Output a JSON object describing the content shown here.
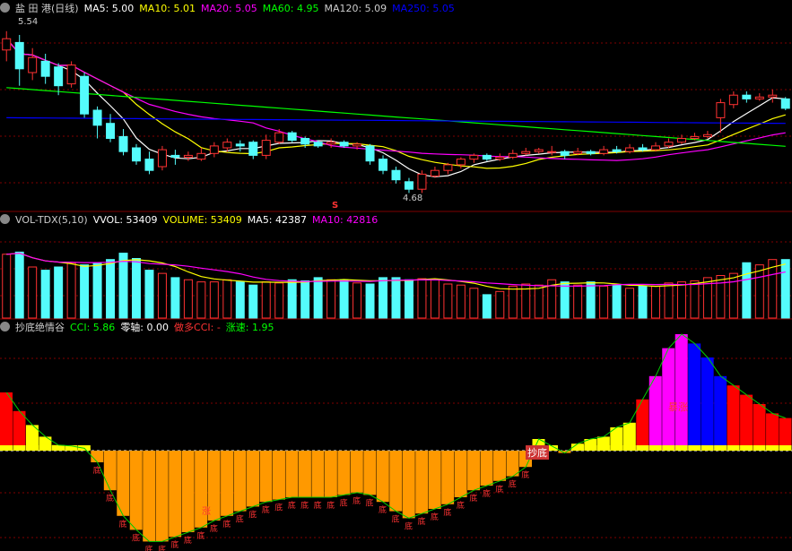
{
  "main_header": {
    "stock": "盐 田 港(日线)",
    "items": [
      {
        "label": "MA5: 5.00",
        "color": "#ffffff"
      },
      {
        "label": "MA10: 5.01",
        "color": "#ffff00"
      },
      {
        "label": "MA20: 5.05",
        "color": "#ff00ff"
      },
      {
        "label": "MA60: 4.95",
        "color": "#00ff00"
      },
      {
        "label": "MA120: 5.09",
        "color": "#cccccc"
      },
      {
        "label": "MA250: 5.05",
        "color": "#0000ff"
      }
    ]
  },
  "vol_header": {
    "title": "VOL-TDX(5,10)",
    "items": [
      {
        "label": "VVOL: 53409",
        "color": "#ffffff"
      },
      {
        "label": "VOLUME: 53409",
        "color": "#ffff00"
      },
      {
        "label": "MA5: 42387",
        "color": "#ffffff"
      },
      {
        "label": "MA10: 42816",
        "color": "#ff00ff"
      }
    ]
  },
  "ind_header": {
    "title": "抄底绝情谷",
    "items": [
      {
        "label": "CCI: 5.86",
        "color": "#00ff00"
      },
      {
        "label": "零轴: 0.00",
        "color": "#ffffff"
      },
      {
        "label": "做多CCI: -",
        "color": "#ff3333"
      },
      {
        "label": "涨速: 1.95",
        "color": "#00ff00"
      }
    ]
  },
  "labels": {
    "high": "5.54",
    "low": "4.68",
    "s_mark": "S",
    "chao_di": "抄底",
    "bao_zhang": "暴涨",
    "zhang": "涨",
    "di": "底"
  },
  "colors": {
    "up": "#ff3232",
    "down": "#54fcfc",
    "grid": "#800000",
    "orange": "#ff9900",
    "magenta": "#ff00ff",
    "blue": "#0000ff",
    "yellow": "#ffff00",
    "red": "#ff0000"
  },
  "chart_data": {
    "type": "candlestick",
    "price_range": [
      4.62,
      5.62
    ],
    "volume_max": 80000,
    "candles": [
      [
        5.44,
        5.5,
        5.54,
        5.38
      ],
      [
        5.48,
        5.34,
        5.52,
        5.25
      ],
      [
        5.32,
        5.4,
        5.45,
        5.28
      ],
      [
        5.38,
        5.3,
        5.42,
        5.26
      ],
      [
        5.35,
        5.25,
        5.37,
        5.2
      ],
      [
        5.26,
        5.36,
        5.38,
        5.24
      ],
      [
        5.3,
        5.1,
        5.32,
        5.08
      ],
      [
        5.12,
        5.04,
        5.14,
        4.97
      ],
      [
        5.05,
        4.97,
        5.1,
        4.95
      ],
      [
        4.98,
        4.9,
        5.02,
        4.88
      ],
      [
        4.92,
        4.85,
        4.94,
        4.83
      ],
      [
        4.86,
        4.8,
        4.9,
        4.78
      ],
      [
        4.82,
        4.91,
        4.93,
        4.8
      ],
      [
        4.88,
        4.87,
        4.91,
        4.83
      ],
      [
        4.87,
        4.88,
        4.9,
        4.85
      ],
      [
        4.86,
        4.89,
        4.92,
        4.85
      ],
      [
        4.89,
        4.93,
        4.95,
        4.87
      ],
      [
        4.92,
        4.95,
        4.97,
        4.9
      ],
      [
        4.94,
        4.93,
        4.96,
        4.9
      ],
      [
        4.95,
        4.88,
        4.96,
        4.86
      ],
      [
        4.88,
        4.96,
        4.99,
        4.86
      ],
      [
        4.95,
        5.0,
        5.02,
        4.94
      ],
      [
        5.0,
        4.96,
        5.01,
        4.95
      ],
      [
        4.97,
        4.94,
        4.98,
        4.92
      ],
      [
        4.95,
        4.93,
        4.96,
        4.92
      ],
      [
        4.94,
        4.95,
        4.97,
        4.92
      ],
      [
        4.95,
        4.93,
        4.96,
        4.92
      ],
      [
        4.93,
        4.94,
        4.95,
        4.91
      ],
      [
        4.93,
        4.85,
        4.94,
        4.83
      ],
      [
        4.86,
        4.8,
        4.88,
        4.78
      ],
      [
        4.8,
        4.75,
        4.82,
        4.73
      ],
      [
        4.74,
        4.7,
        4.76,
        4.68
      ],
      [
        4.7,
        4.78,
        4.8,
        4.68
      ],
      [
        4.77,
        4.8,
        4.82,
        4.76
      ],
      [
        4.8,
        4.83,
        4.84,
        4.78
      ],
      [
        4.83,
        4.86,
        4.87,
        4.81
      ],
      [
        4.86,
        4.88,
        4.89,
        4.84
      ],
      [
        4.88,
        4.86,
        4.89,
        4.85
      ],
      [
        4.86,
        4.87,
        4.89,
        4.85
      ],
      [
        4.87,
        4.89,
        4.91,
        4.86
      ],
      [
        4.89,
        4.9,
        4.92,
        4.88
      ],
      [
        4.9,
        4.91,
        4.92,
        4.89
      ],
      [
        4.9,
        4.9,
        4.93,
        4.88
      ],
      [
        4.9,
        4.88,
        4.91,
        4.86
      ],
      [
        4.89,
        4.9,
        4.92,
        4.88
      ],
      [
        4.9,
        4.89,
        4.91,
        4.88
      ],
      [
        4.89,
        4.91,
        4.93,
        4.88
      ],
      [
        4.91,
        4.9,
        4.93,
        4.89
      ],
      [
        4.9,
        4.92,
        4.94,
        4.89
      ],
      [
        4.92,
        4.91,
        4.94,
        4.9
      ],
      [
        4.91,
        4.93,
        4.95,
        4.9
      ],
      [
        4.93,
        4.95,
        4.97,
        4.92
      ],
      [
        4.95,
        4.97,
        4.99,
        4.94
      ],
      [
        4.97,
        4.98,
        5.0,
        4.96
      ],
      [
        4.98,
        4.99,
        5.01,
        4.97
      ],
      [
        5.08,
        5.16,
        5.18,
        5.0
      ],
      [
        5.15,
        5.2,
        5.22,
        5.13
      ],
      [
        5.2,
        5.18,
        5.22,
        5.16
      ],
      [
        5.18,
        5.19,
        5.21,
        5.17
      ],
      [
        5.19,
        5.2,
        5.23,
        5.16
      ],
      [
        5.18,
        5.13,
        5.19,
        5.12
      ]
    ],
    "volumes": [
      60000,
      62000,
      48000,
      45000,
      48000,
      52000,
      50000,
      52000,
      55000,
      61000,
      56000,
      45000,
      42000,
      38000,
      36000,
      34000,
      34000,
      36000,
      34000,
      31000,
      34000,
      33000,
      36000,
      35000,
      38000,
      36000,
      36000,
      33000,
      32000,
      38000,
      38000,
      36000,
      37000,
      36000,
      32000,
      31000,
      28000,
      22000,
      25000,
      30000,
      32000,
      31000,
      36000,
      34000,
      31000,
      34000,
      30000,
      31000,
      28000,
      30000,
      30000,
      33000,
      34000,
      35000,
      38000,
      40000,
      42000,
      52000,
      50000,
      55000,
      55000
    ],
    "cci": [
      125,
      85,
      55,
      30,
      12,
      10,
      5,
      -25,
      -85,
      -140,
      -170,
      -195,
      -195,
      -185,
      -175,
      -165,
      -150,
      -140,
      -130,
      -120,
      -110,
      -105,
      -100,
      -100,
      -100,
      -100,
      -95,
      -90,
      -95,
      -110,
      -130,
      -145,
      -135,
      -125,
      -115,
      -100,
      -85,
      -75,
      -65,
      -55,
      -35,
      25,
      10,
      -5,
      15,
      25,
      30,
      50,
      60,
      110,
      160,
      220,
      250,
      230,
      200,
      160,
      140,
      120,
      100,
      80,
      70
    ]
  }
}
